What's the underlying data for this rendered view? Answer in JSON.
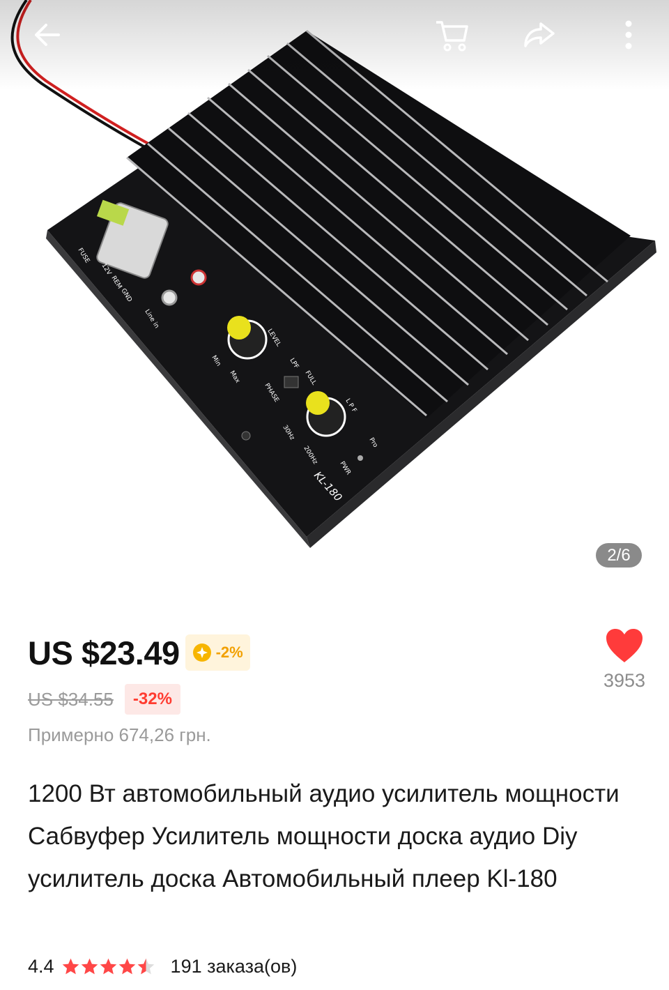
{
  "topbar": {
    "back_icon": "arrow-left-icon",
    "cart_icon": "cart-icon",
    "share_icon": "share-icon",
    "more_icon": "more-vertical-icon"
  },
  "gallery": {
    "page_indicator": "2/6",
    "image_labels": {
      "fuse": "FUSE",
      "v12": "12V",
      "rem": "REM",
      "gnd": "GND",
      "line_in": "Line in",
      "level": "LEVEL",
      "min": "Min",
      "max": "Max",
      "phase": "PHASE",
      "lpf": "LPF",
      "full": "FULL",
      "lpf_knob": "L P F",
      "hz30": "30Hz",
      "hz200": "200Hz",
      "pwr": "PWR",
      "pro": "Pro",
      "model": "KL-180"
    }
  },
  "price": {
    "current": "US $23.49",
    "coin_discount": "-2%",
    "original": "US $34.55",
    "discount": "-32%",
    "approx": "Примерно 674,26 грн."
  },
  "wishlist": {
    "icon": "heart-icon",
    "count": "3953"
  },
  "product": {
    "title": "1200 Вт автомобильный аудио усилитель мощности Сабвуфер Усилитель мощности доска аудио Diy усилитель доска Автомобильный плеер Kl-180",
    "rating": "4.4",
    "rating_value": 4.4,
    "orders": "191 заказа(ов)"
  },
  "colors": {
    "price_red": "#ff3b30",
    "coin_orange": "#f2a000",
    "star_red": "#ff4747",
    "heart_red": "#ff3b3b",
    "muted_gray": "#9a9a9a"
  }
}
